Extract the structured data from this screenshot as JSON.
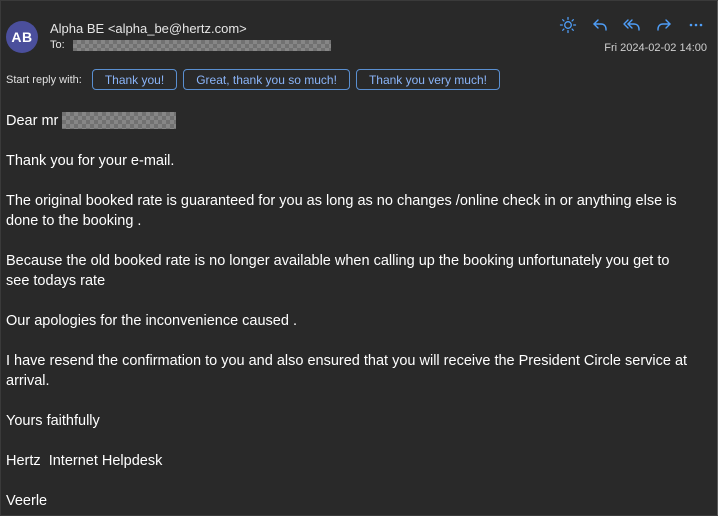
{
  "sender": {
    "initials": "AB",
    "from": "Alpha BE <alpha_be@hertz.com>",
    "to_label": "To:",
    "date": "Fri 2024-02-02 14:00"
  },
  "actions": {
    "icons": [
      "sun-icon",
      "reply-icon",
      "reply-all-icon",
      "forward-icon",
      "more-icon"
    ],
    "accent_color": "#4f9ef8"
  },
  "quick_reply": {
    "label": "Start reply with:",
    "options": [
      "Thank you!",
      "Great, thank you so much!",
      "Thank you very much!"
    ]
  },
  "message": {
    "greeting": "Dear mr",
    "paragraphs": [
      "Thank you for your e-mail.",
      "The original booked rate is guaranteed for you as long as no changes /online check in or anything else is done to the booking .",
      "Because the old booked rate is no longer available when calling up the booking unfortunately you get to see todays rate",
      "Our apologies for the inconvenience caused .",
      "I have resend the confirmation to you and also ensured that you will receive the President Circle service at arrival.",
      "Yours faithfully",
      "Hertz  Internet Helpdesk",
      "Veerle"
    ]
  }
}
